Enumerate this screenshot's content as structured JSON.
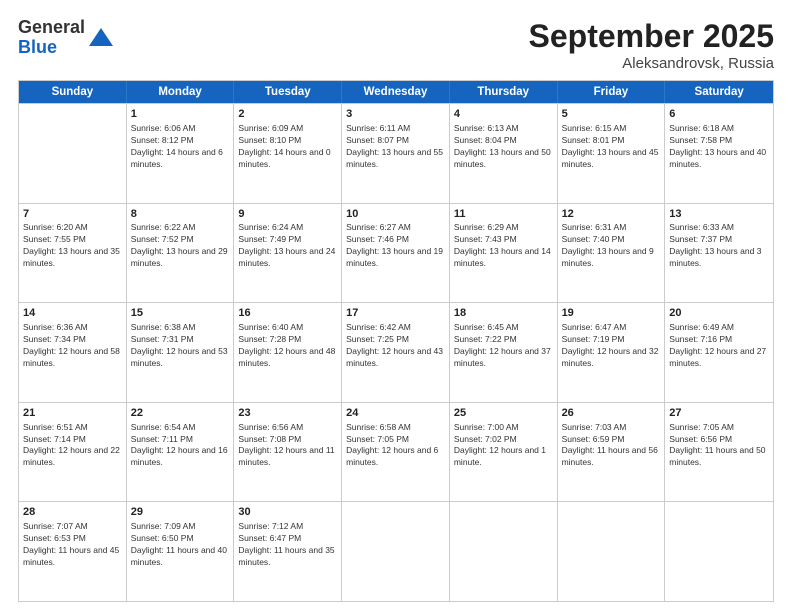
{
  "header": {
    "logo_line1": "General",
    "logo_line2": "Blue",
    "month_year": "September 2025",
    "location": "Aleksandrovsk, Russia"
  },
  "weekdays": [
    "Sunday",
    "Monday",
    "Tuesday",
    "Wednesday",
    "Thursday",
    "Friday",
    "Saturday"
  ],
  "rows": [
    [
      {
        "day": "",
        "sunrise": "",
        "sunset": "",
        "daylight": ""
      },
      {
        "day": "1",
        "sunrise": "Sunrise: 6:06 AM",
        "sunset": "Sunset: 8:12 PM",
        "daylight": "Daylight: 14 hours and 6 minutes."
      },
      {
        "day": "2",
        "sunrise": "Sunrise: 6:09 AM",
        "sunset": "Sunset: 8:10 PM",
        "daylight": "Daylight: 14 hours and 0 minutes."
      },
      {
        "day": "3",
        "sunrise": "Sunrise: 6:11 AM",
        "sunset": "Sunset: 8:07 PM",
        "daylight": "Daylight: 13 hours and 55 minutes."
      },
      {
        "day": "4",
        "sunrise": "Sunrise: 6:13 AM",
        "sunset": "Sunset: 8:04 PM",
        "daylight": "Daylight: 13 hours and 50 minutes."
      },
      {
        "day": "5",
        "sunrise": "Sunrise: 6:15 AM",
        "sunset": "Sunset: 8:01 PM",
        "daylight": "Daylight: 13 hours and 45 minutes."
      },
      {
        "day": "6",
        "sunrise": "Sunrise: 6:18 AM",
        "sunset": "Sunset: 7:58 PM",
        "daylight": "Daylight: 13 hours and 40 minutes."
      }
    ],
    [
      {
        "day": "7",
        "sunrise": "Sunrise: 6:20 AM",
        "sunset": "Sunset: 7:55 PM",
        "daylight": "Daylight: 13 hours and 35 minutes."
      },
      {
        "day": "8",
        "sunrise": "Sunrise: 6:22 AM",
        "sunset": "Sunset: 7:52 PM",
        "daylight": "Daylight: 13 hours and 29 minutes."
      },
      {
        "day": "9",
        "sunrise": "Sunrise: 6:24 AM",
        "sunset": "Sunset: 7:49 PM",
        "daylight": "Daylight: 13 hours and 24 minutes."
      },
      {
        "day": "10",
        "sunrise": "Sunrise: 6:27 AM",
        "sunset": "Sunset: 7:46 PM",
        "daylight": "Daylight: 13 hours and 19 minutes."
      },
      {
        "day": "11",
        "sunrise": "Sunrise: 6:29 AM",
        "sunset": "Sunset: 7:43 PM",
        "daylight": "Daylight: 13 hours and 14 minutes."
      },
      {
        "day": "12",
        "sunrise": "Sunrise: 6:31 AM",
        "sunset": "Sunset: 7:40 PM",
        "daylight": "Daylight: 13 hours and 9 minutes."
      },
      {
        "day": "13",
        "sunrise": "Sunrise: 6:33 AM",
        "sunset": "Sunset: 7:37 PM",
        "daylight": "Daylight: 13 hours and 3 minutes."
      }
    ],
    [
      {
        "day": "14",
        "sunrise": "Sunrise: 6:36 AM",
        "sunset": "Sunset: 7:34 PM",
        "daylight": "Daylight: 12 hours and 58 minutes."
      },
      {
        "day": "15",
        "sunrise": "Sunrise: 6:38 AM",
        "sunset": "Sunset: 7:31 PM",
        "daylight": "Daylight: 12 hours and 53 minutes."
      },
      {
        "day": "16",
        "sunrise": "Sunrise: 6:40 AM",
        "sunset": "Sunset: 7:28 PM",
        "daylight": "Daylight: 12 hours and 48 minutes."
      },
      {
        "day": "17",
        "sunrise": "Sunrise: 6:42 AM",
        "sunset": "Sunset: 7:25 PM",
        "daylight": "Daylight: 12 hours and 43 minutes."
      },
      {
        "day": "18",
        "sunrise": "Sunrise: 6:45 AM",
        "sunset": "Sunset: 7:22 PM",
        "daylight": "Daylight: 12 hours and 37 minutes."
      },
      {
        "day": "19",
        "sunrise": "Sunrise: 6:47 AM",
        "sunset": "Sunset: 7:19 PM",
        "daylight": "Daylight: 12 hours and 32 minutes."
      },
      {
        "day": "20",
        "sunrise": "Sunrise: 6:49 AM",
        "sunset": "Sunset: 7:16 PM",
        "daylight": "Daylight: 12 hours and 27 minutes."
      }
    ],
    [
      {
        "day": "21",
        "sunrise": "Sunrise: 6:51 AM",
        "sunset": "Sunset: 7:14 PM",
        "daylight": "Daylight: 12 hours and 22 minutes."
      },
      {
        "day": "22",
        "sunrise": "Sunrise: 6:54 AM",
        "sunset": "Sunset: 7:11 PM",
        "daylight": "Daylight: 12 hours and 16 minutes."
      },
      {
        "day": "23",
        "sunrise": "Sunrise: 6:56 AM",
        "sunset": "Sunset: 7:08 PM",
        "daylight": "Daylight: 12 hours and 11 minutes."
      },
      {
        "day": "24",
        "sunrise": "Sunrise: 6:58 AM",
        "sunset": "Sunset: 7:05 PM",
        "daylight": "Daylight: 12 hours and 6 minutes."
      },
      {
        "day": "25",
        "sunrise": "Sunrise: 7:00 AM",
        "sunset": "Sunset: 7:02 PM",
        "daylight": "Daylight: 12 hours and 1 minute."
      },
      {
        "day": "26",
        "sunrise": "Sunrise: 7:03 AM",
        "sunset": "Sunset: 6:59 PM",
        "daylight": "Daylight: 11 hours and 56 minutes."
      },
      {
        "day": "27",
        "sunrise": "Sunrise: 7:05 AM",
        "sunset": "Sunset: 6:56 PM",
        "daylight": "Daylight: 11 hours and 50 minutes."
      }
    ],
    [
      {
        "day": "28",
        "sunrise": "Sunrise: 7:07 AM",
        "sunset": "Sunset: 6:53 PM",
        "daylight": "Daylight: 11 hours and 45 minutes."
      },
      {
        "day": "29",
        "sunrise": "Sunrise: 7:09 AM",
        "sunset": "Sunset: 6:50 PM",
        "daylight": "Daylight: 11 hours and 40 minutes."
      },
      {
        "day": "30",
        "sunrise": "Sunrise: 7:12 AM",
        "sunset": "Sunset: 6:47 PM",
        "daylight": "Daylight: 11 hours and 35 minutes."
      },
      {
        "day": "",
        "sunrise": "",
        "sunset": "",
        "daylight": ""
      },
      {
        "day": "",
        "sunrise": "",
        "sunset": "",
        "daylight": ""
      },
      {
        "day": "",
        "sunrise": "",
        "sunset": "",
        "daylight": ""
      },
      {
        "day": "",
        "sunrise": "",
        "sunset": "",
        "daylight": ""
      }
    ]
  ]
}
